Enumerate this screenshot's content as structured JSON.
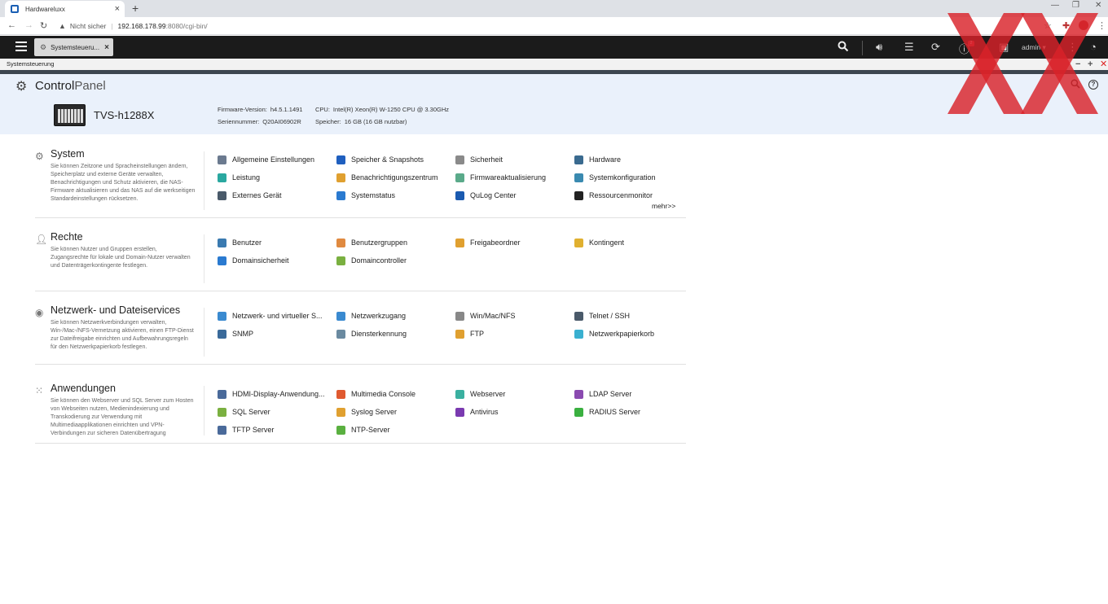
{
  "browser": {
    "tab_title": "Hardwareluxx",
    "tab_close": "×",
    "new_tab": "+",
    "security_label": "Nicht sicher",
    "url_host": "192.168.178.99",
    "url_rest": ":8080/cgi-bin/"
  },
  "qts": {
    "window_tab_label": "Systemsteueru...",
    "window_tab_close": "×",
    "notification_count": "2",
    "user": "admin ▾"
  },
  "window": {
    "title": "Systemsteuerung"
  },
  "header": {
    "title_bold": "Control",
    "title_light": "Panel",
    "model": "TVS-h1288X",
    "firmware_label": "Firmware-Version:",
    "firmware_value": "h4.5.1.1491",
    "serial_label": "Seriennummer:",
    "serial_value": "Q20AI06902R",
    "cpu_label": "CPU:",
    "cpu_value": "Intel(R) Xeon(R) W-1250 CPU @ 3.30GHz",
    "memory_label": "Speicher:",
    "memory_value": "16 GB (16 GB nutzbar)"
  },
  "sections": [
    {
      "title": "System",
      "icon": "gear-icon",
      "description": "Sie können Zeitzone und Spracheinstellungen ändern, Speicherplatz und externe Geräte verwalten, Benachrichtigungen und Schutz aktivieren, die NAS-Firmware aktualisieren und das NAS auf die werkseitigen Standardeinstellungen rücksetzen.",
      "items": [
        {
          "label": "Allgemeine Einstellungen",
          "icon": "general-settings-icon",
          "color": "#6b7a8f"
        },
        {
          "label": "Speicher & Snapshots",
          "icon": "storage-icon",
          "color": "#1f5fbf"
        },
        {
          "label": "Sicherheit",
          "icon": "lock-icon",
          "color": "#8a8a8a"
        },
        {
          "label": "Hardware",
          "icon": "hardware-icon",
          "color": "#3a6a8f"
        },
        {
          "label": "Leistung",
          "icon": "bulb-icon",
          "color": "#2aa8a0"
        },
        {
          "label": "Benachrichtigungszentrum",
          "icon": "notification-icon",
          "color": "#e0a030"
        },
        {
          "label": "Firmwareaktualisierung",
          "icon": "firmware-icon",
          "color": "#5aaa8a"
        },
        {
          "label": "Systemkonfiguration",
          "icon": "system-config-icon",
          "color": "#3a8ab0"
        },
        {
          "label": "Externes Gerät",
          "icon": "external-device-icon",
          "color": "#4a5a6a"
        },
        {
          "label": "Systemstatus",
          "icon": "system-status-icon",
          "color": "#2a7ad0"
        },
        {
          "label": "QuLog Center",
          "icon": "qulog-icon",
          "color": "#1a5ab0"
        },
        {
          "label": "Ressourcenmonitor",
          "icon": "resource-monitor-icon",
          "color": "#222"
        }
      ],
      "more": "mehr>>"
    },
    {
      "title": "Rechte",
      "icon": "user-icon",
      "description": "Sie können Nutzer und Gruppen erstellen, Zugangsrechte für lokale und Domain-Nutzer verwalten und Datenträgerkontingente festlegen.",
      "items": [
        {
          "label": "Benutzer",
          "icon": "user-icon",
          "color": "#3a7ab0"
        },
        {
          "label": "Benutzergruppen",
          "icon": "group-icon",
          "color": "#e08a40"
        },
        {
          "label": "Freigabeordner",
          "icon": "folder-icon",
          "color": "#e0a030"
        },
        {
          "label": "Kontingent",
          "icon": "quota-icon",
          "color": "#e0b030"
        },
        {
          "label": "Domainsicherheit",
          "icon": "domain-security-icon",
          "color": "#2a7ad0"
        },
        {
          "label": "Domaincontroller",
          "icon": "domain-controller-icon",
          "color": "#7ab040"
        }
      ]
    },
    {
      "title": "Netzwerk- und Dateiservices",
      "icon": "network-icon",
      "description": "Sie können Netzwerkverbindungen verwalten, Win-/Mac-/NFS-Vernetzung aktivieren, einen FTP-Dienst zur Dateifreigabe einrichten und Aufbewahrungsregeln für den Netzwerkpapierkorb festlegen.",
      "items": [
        {
          "label": "Netzwerk- und virtueller S...",
          "icon": "network-switch-icon",
          "color": "#3a8ad0"
        },
        {
          "label": "Netzwerkzugang",
          "icon": "network-access-icon",
          "color": "#3a8ad0"
        },
        {
          "label": "Win/Mac/NFS",
          "icon": "win-mac-nfs-icon",
          "color": "#888"
        },
        {
          "label": "Telnet / SSH",
          "icon": "terminal-icon",
          "color": "#4a5a6a"
        },
        {
          "label": "SNMP",
          "icon": "snmp-icon",
          "color": "#3a6a9a"
        },
        {
          "label": "Diensterkennung",
          "icon": "service-discovery-icon",
          "color": "#6a8aa0"
        },
        {
          "label": "FTP",
          "icon": "ftp-icon",
          "color": "#e0a030"
        },
        {
          "label": "Netzwerkpapierkorb",
          "icon": "recycle-bin-icon",
          "color": "#3ab0d0"
        }
      ]
    },
    {
      "title": "Anwendungen",
      "icon": "apps-icon",
      "description": "Sie können den Webserver und SQL Server zum Hosten von Webseiten nutzen, Medienindexierung und Transkodierung zur Verwendung mit Multimediaapplikationen einrichten und VPN-Verbindungen zur sicheren Datenübertragung",
      "items": [
        {
          "label": "HDMI-Display-Anwendung...",
          "icon": "hdmi-icon",
          "color": "#4a6a9a"
        },
        {
          "label": "Multimedia Console",
          "icon": "multimedia-icon",
          "color": "#e05a30"
        },
        {
          "label": "Webserver",
          "icon": "webserver-icon",
          "color": "#3ab0a0"
        },
        {
          "label": "LDAP Server",
          "icon": "ldap-icon",
          "color": "#8a4ab0"
        },
        {
          "label": "SQL Server",
          "icon": "sql-icon",
          "color": "#7ab040"
        },
        {
          "label": "Syslog Server",
          "icon": "syslog-icon",
          "color": "#e0a030"
        },
        {
          "label": "Antivirus",
          "icon": "antivirus-icon",
          "color": "#7a3ab0"
        },
        {
          "label": "RADIUS Server",
          "icon": "radius-icon",
          "color": "#3ab040"
        },
        {
          "label": "TFTP Server",
          "icon": "tftp-icon",
          "color": "#4a6a9a"
        },
        {
          "label": "NTP-Server",
          "icon": "ntp-icon",
          "color": "#5ab040"
        }
      ]
    }
  ],
  "colors": {
    "header_bg": "#eaf1fb",
    "qts_bar": "#1b1b1b",
    "watermark": "#d9222a"
  }
}
